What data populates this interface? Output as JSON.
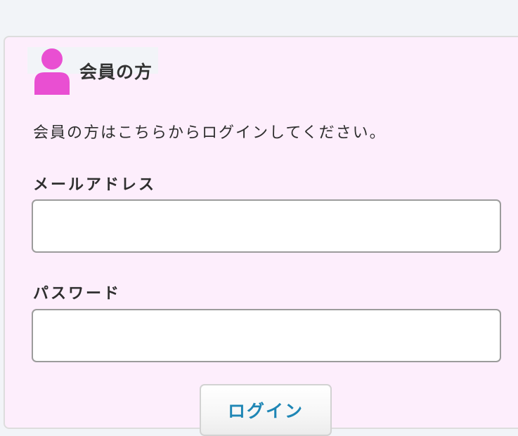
{
  "section": {
    "title": "会員の方",
    "icon": "user-icon",
    "icon_color": "#e94fd2"
  },
  "intro_text": "会員の方はこちらからログインしてください。",
  "email": {
    "label": "メールアドレス",
    "value": "",
    "placeholder": ""
  },
  "password": {
    "label": "パスワード",
    "value": "",
    "placeholder": ""
  },
  "login_button": {
    "label": "ログイン",
    "color": "#1e86b5"
  },
  "colors": {
    "page_background": "#f2f4f8",
    "panel_background": "#fdeefc"
  }
}
